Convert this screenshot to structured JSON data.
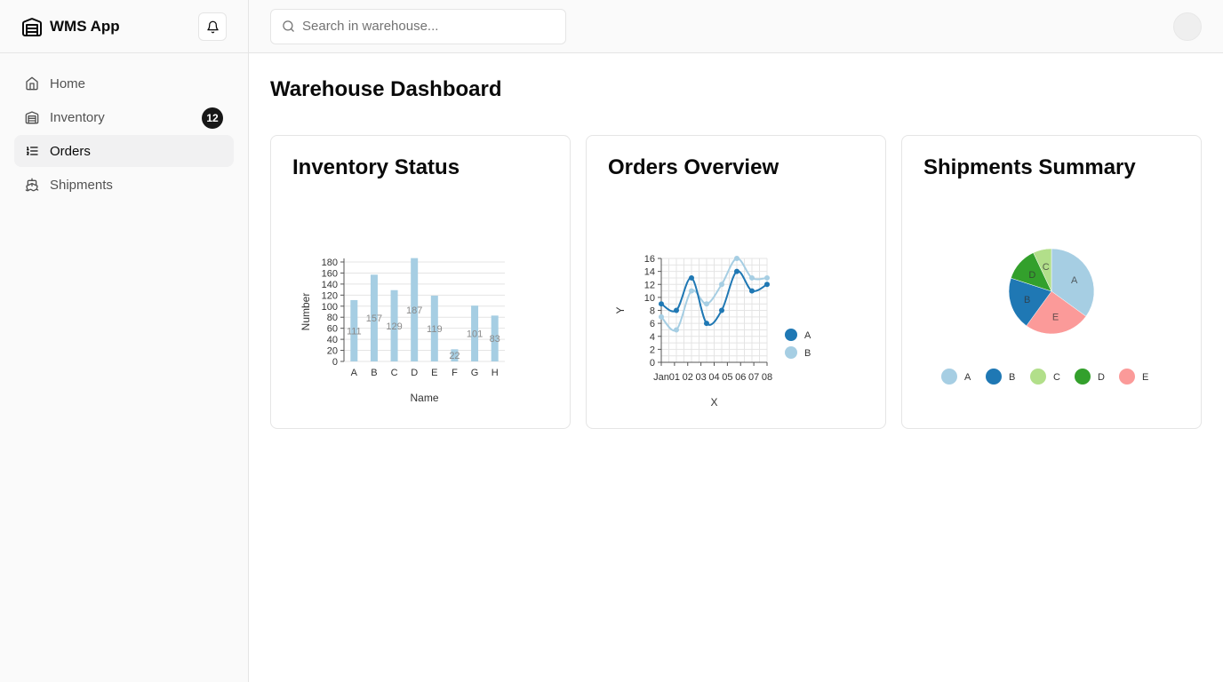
{
  "app": {
    "name": "WMS App"
  },
  "sidebar": {
    "items": [
      {
        "label": "Home",
        "icon": "home-icon"
      },
      {
        "label": "Inventory",
        "icon": "warehouse-icon",
        "badge": "12"
      },
      {
        "label": "Orders",
        "icon": "list-icon",
        "active": true
      },
      {
        "label": "Shipments",
        "icon": "ship-icon"
      }
    ]
  },
  "search": {
    "placeholder": "Search in warehouse..."
  },
  "page": {
    "title": "Warehouse Dashboard"
  },
  "cards": [
    {
      "title": "Inventory Status"
    },
    {
      "title": "Orders Overview"
    },
    {
      "title": "Shipments Summary"
    }
  ],
  "chart_data": [
    {
      "type": "bar",
      "title": "Inventory Status",
      "xlabel": "Name",
      "ylabel": "Number",
      "categories": [
        "A",
        "B",
        "C",
        "D",
        "E",
        "F",
        "G",
        "H"
      ],
      "values": [
        111,
        157,
        129,
        187,
        119,
        22,
        101,
        83
      ],
      "ylim": [
        0,
        180
      ],
      "yticks": [
        0,
        20,
        40,
        60,
        80,
        100,
        120,
        140,
        160,
        180
      ],
      "color": "#a6cee3"
    },
    {
      "type": "line",
      "title": "Orders Overview",
      "xlabel": "X",
      "ylabel": "Y",
      "xticks": [
        "Jan",
        "01",
        "02",
        "03",
        "04",
        "05",
        "06",
        "07",
        "08"
      ],
      "series": [
        {
          "name": "A",
          "color": "#1f78b4",
          "values": [
            9,
            8,
            13,
            6,
            8,
            14,
            11,
            12
          ]
        },
        {
          "name": "B",
          "color": "#a6cee3",
          "values": [
            7,
            5,
            11,
            9,
            12,
            16,
            13,
            13
          ]
        }
      ],
      "ylim": [
        0,
        16
      ],
      "yticks": [
        0,
        2,
        4,
        6,
        8,
        10,
        12,
        14,
        16
      ],
      "grid": true,
      "legend": "right"
    },
    {
      "type": "pie",
      "title": "Shipments Summary",
      "slices": [
        {
          "label": "A",
          "value": 35,
          "color": "#a6cee3"
        },
        {
          "label": "E",
          "value": 25,
          "color": "#fb9a99"
        },
        {
          "label": "B",
          "value": 20,
          "color": "#1f78b4"
        },
        {
          "label": "D",
          "value": 13,
          "color": "#33a02c"
        },
        {
          "label": "C",
          "value": 7,
          "color": "#b2df8a"
        }
      ],
      "legend_order": [
        "A",
        "B",
        "C",
        "D",
        "E"
      ],
      "legend": "bottom"
    }
  ]
}
